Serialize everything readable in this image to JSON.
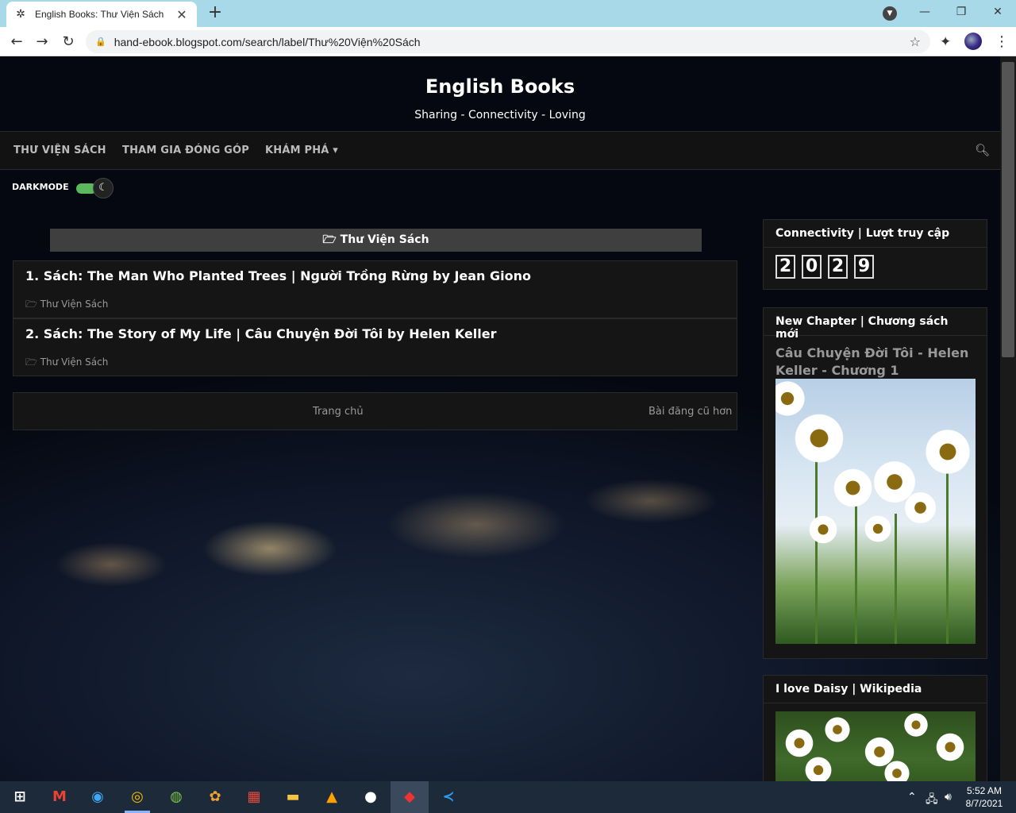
{
  "browser": {
    "tab_title": "English Books: Thư Viện Sách",
    "tab_close": "✕",
    "new_tab": "+",
    "url": "hand-ebook.blogspot.com/search/label/Thư%20Viện%20Sách",
    "window_controls": {
      "minimize": "—",
      "restore": "❐",
      "close": "✕"
    }
  },
  "site": {
    "title": "English Books",
    "description": "Sharing - Connectivity - Loving"
  },
  "nav": {
    "items": [
      {
        "label": "THƯ VIỆN SÁCH"
      },
      {
        "label": "THAM GIA ĐÓNG GÓP"
      },
      {
        "label": "KHÁM PHÁ ▾"
      }
    ],
    "search_icon": "search-icon"
  },
  "darkmode": {
    "label": "DARKMODE",
    "enabled": true
  },
  "label_banner": {
    "icon": "folder-open-icon",
    "text": "Thư Viện Sách"
  },
  "posts": [
    {
      "title": "1. Sách: The Man Who Planted Trees | Người Trồng Rừng by Jean Giono",
      "label": "Thư Viện Sách"
    },
    {
      "title": "2. Sách: The Story of My Life | Câu Chuyện Đời Tôi by Helen Keller",
      "label": "Thư Viện Sách"
    }
  ],
  "pager": {
    "home": "Trang chủ",
    "older": "Bài đăng cũ hơn"
  },
  "sidebar": {
    "counter": {
      "title": "Connectivity | Lượt truy cập",
      "digits": [
        "2",
        "0",
        "2",
        "9"
      ]
    },
    "new_chapter": {
      "title": "New Chapter | Chương sách mới",
      "link": "Câu Chuyện Đời Tôi - Helen Keller - Chương 1"
    },
    "daisy": {
      "title": "I love Daisy | Wikipedia"
    }
  },
  "taskbar": {
    "time": "5:52 AM",
    "date": "8/7/2021"
  }
}
